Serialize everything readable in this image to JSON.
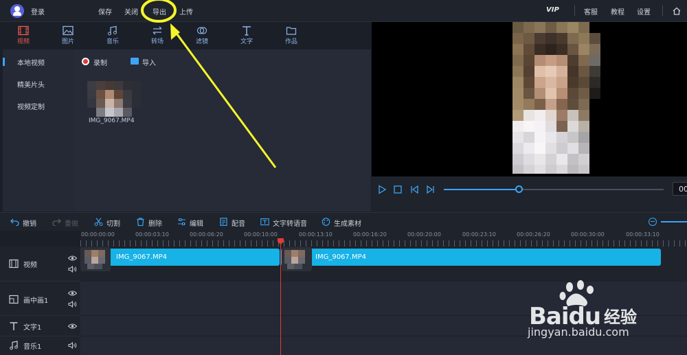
{
  "topbar": {
    "login": "登录",
    "menu": [
      "保存",
      "关闭",
      "导出",
      "上传"
    ],
    "vip": "VIP",
    "right": [
      "客服",
      "教程",
      "设置"
    ]
  },
  "category_tabs": [
    "视频",
    "图片",
    "音乐",
    "转场",
    "滤镜",
    "文字",
    "作品"
  ],
  "active_category": "视频",
  "left_nav": [
    "本地视频",
    "精美片头",
    "视频定制"
  ],
  "media_actions": {
    "record": "录制",
    "import": "导入"
  },
  "media_items": [
    {
      "name": "IMG_9067.MP4"
    }
  ],
  "player": {
    "progress": 0.34,
    "time_display": "00"
  },
  "edit_toolbar": [
    {
      "label": "撤销",
      "enabled": true
    },
    {
      "label": "重做",
      "enabled": false
    },
    {
      "label": "切割",
      "enabled": true
    },
    {
      "label": "删除",
      "enabled": true
    },
    {
      "label": "编辑",
      "enabled": true
    },
    {
      "label": "配音",
      "enabled": true
    },
    {
      "label": "文字转语音",
      "enabled": true
    },
    {
      "label": "生成素材",
      "enabled": true
    }
  ],
  "ruler_labels": [
    "00:00:00:00",
    "00:00:03:10",
    "00:00:06:20",
    "00:00:10:00",
    "00:00:13:10",
    "00:00:16:20",
    "00:00:20:00",
    "00:00:23:10",
    "00:00:26:20",
    "00:00:30:00",
    "00:00:33:10"
  ],
  "tracks": [
    {
      "name": "视频",
      "eye": true,
      "audio": true
    },
    {
      "name": "画中画1",
      "eye": true,
      "audio": true
    },
    {
      "name": "文字1",
      "eye": true,
      "audio": false
    },
    {
      "name": "音乐1",
      "eye": false,
      "audio": true
    }
  ],
  "clips": [
    {
      "name": "IMG_9067.MP4"
    },
    {
      "name": "IMG_9067.MP4"
    }
  ],
  "colors": {
    "accent": "#3da5f5",
    "clip": "#17b2e6",
    "playhead": "#e53b36",
    "annotation": "#f5f52a"
  },
  "watermark": {
    "brand": "Baidu",
    "cn": "经验",
    "url": "jingyan.baidu.com"
  }
}
